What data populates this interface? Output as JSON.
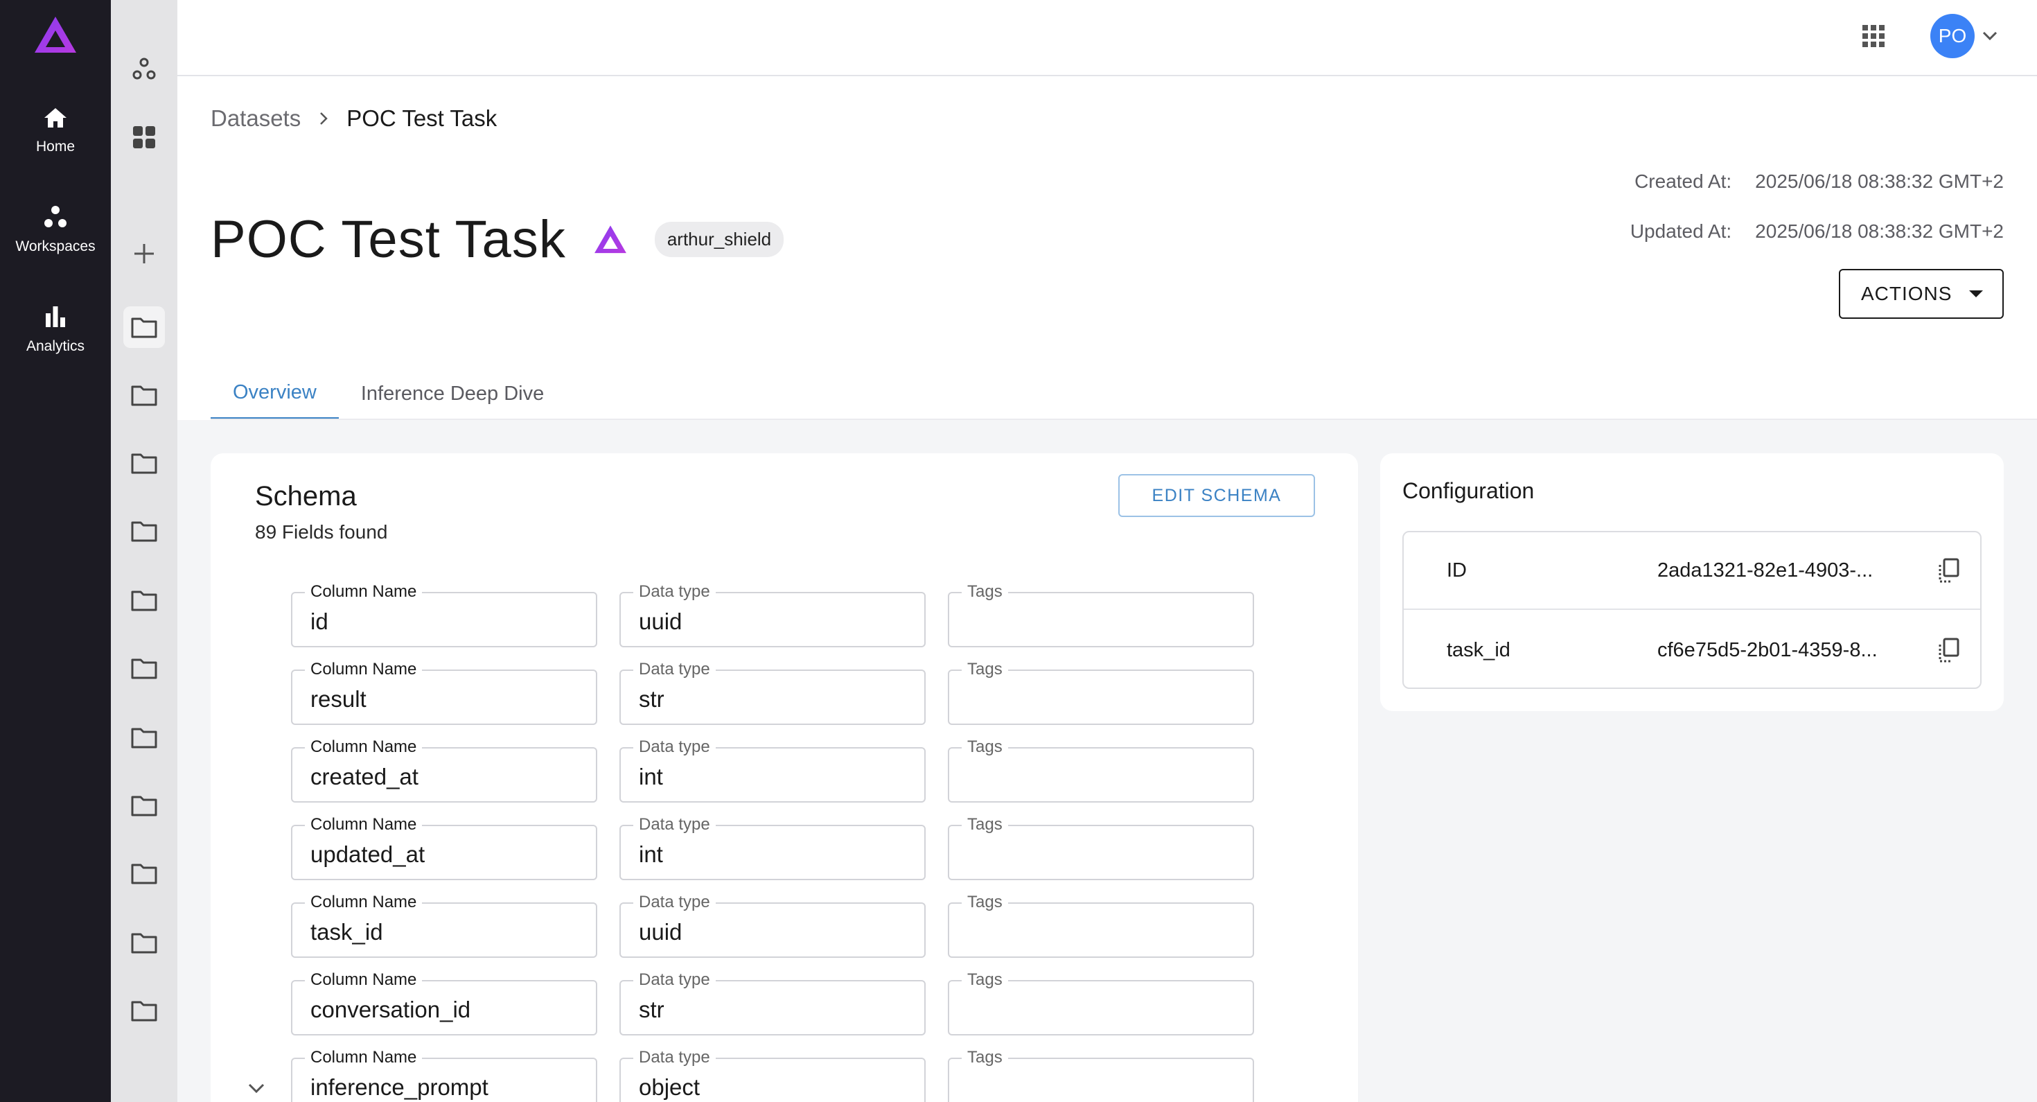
{
  "nav": {
    "items": [
      {
        "label": "Home",
        "icon": "home-icon"
      },
      {
        "label": "Workspaces",
        "icon": "workspaces-icon"
      },
      {
        "label": "Analytics",
        "icon": "analytics-icon"
      }
    ]
  },
  "topbar": {
    "avatar_initials": "PO"
  },
  "breadcrumb": {
    "parent": "Datasets",
    "current": "POC Test Task"
  },
  "page": {
    "title": "POC Test Task",
    "tag": "arthur_shield",
    "created_label": "Created At:",
    "created_value": "2025/06/18 08:38:32 GMT+2",
    "updated_label": "Updated At:",
    "updated_value": "2025/06/18 08:38:32 GMT+2",
    "actions_label": "ACTIONS"
  },
  "tabs": [
    {
      "label": "Overview",
      "active": true
    },
    {
      "label": "Inference Deep Dive",
      "active": false
    }
  ],
  "schema": {
    "title": "Schema",
    "count_text": "89 Fields found",
    "edit_label": "EDIT SCHEMA",
    "column_label": "Column Name",
    "type_label": "Data type",
    "tags_label": "Tags",
    "rows": [
      {
        "column": "id",
        "type": "uuid"
      },
      {
        "column": "result",
        "type": "str"
      },
      {
        "column": "created_at",
        "type": "int"
      },
      {
        "column": "updated_at",
        "type": "int"
      },
      {
        "column": "task_id",
        "type": "uuid"
      },
      {
        "column": "conversation_id",
        "type": "str"
      },
      {
        "column": "inference_prompt",
        "type": "object"
      }
    ]
  },
  "config": {
    "title": "Configuration",
    "rows": [
      {
        "key": "ID",
        "value": "2ada1321-82e1-4903-..."
      },
      {
        "key": "task_id",
        "value": "cf6e75d5-2b01-4359-8..."
      }
    ]
  },
  "colors": {
    "brand": "#a93ae8",
    "accent": "#3b82c4",
    "nav_bg": "#1c1b23"
  }
}
